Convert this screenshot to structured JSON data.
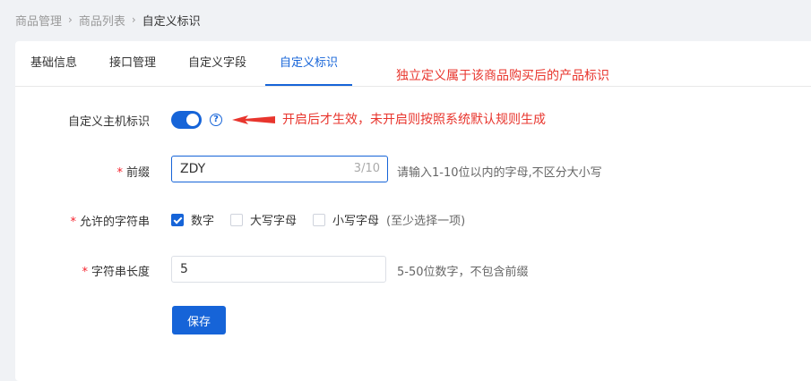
{
  "breadcrumb": {
    "items": [
      "商品管理",
      "商品列表",
      "自定义标识"
    ]
  },
  "tabs": [
    {
      "label": "基础信息",
      "active": false
    },
    {
      "label": "接口管理",
      "active": false
    },
    {
      "label": "自定义字段",
      "active": false
    },
    {
      "label": "自定义标识",
      "active": true
    }
  ],
  "annotations": {
    "tab_note": "独立定义属于该商品购买后的产品标识",
    "switch_note": "开启后才生效，未开启则按照系统默认规则生成"
  },
  "form": {
    "custom_host_label": "自定义主机标识",
    "custom_host_enabled": true,
    "prefix": {
      "required_mark": "*",
      "label": "前缀",
      "value": "ZDY",
      "counter": "3/10",
      "hint": "请输入1-10位以内的字母,不区分大小写"
    },
    "allowed_chars": {
      "required_mark": "*",
      "label": "允许的字符串",
      "options": [
        {
          "label": "数字",
          "checked": true
        },
        {
          "label": "大写字母",
          "checked": false
        },
        {
          "label": "小写字母",
          "checked": false
        }
      ],
      "hint": "(至少选择一项)"
    },
    "length": {
      "required_mark": "*",
      "label": "字符串长度",
      "value": "5",
      "hint": "5-50位数字，不包含前缀"
    },
    "save_label": "保存"
  },
  "colors": {
    "accent": "#1664d8",
    "annotation": "#e8352d",
    "required": "#f5222d"
  }
}
